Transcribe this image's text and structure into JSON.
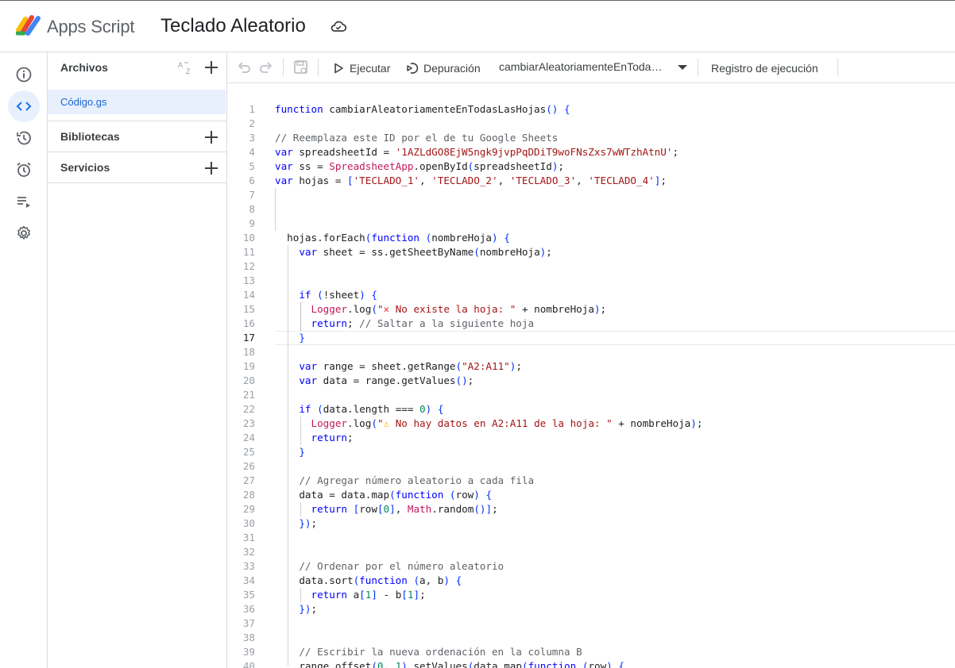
{
  "header": {
    "app_name": "Apps Script",
    "project_title": "Teclado Aleatorio",
    "logo_icon": "apps-script-logo",
    "status_icon": "cloud-saved-icon"
  },
  "rail": {
    "items": [
      {
        "name": "overview",
        "icon": "info-icon"
      },
      {
        "name": "editor",
        "icon": "code-icon",
        "active": true
      },
      {
        "name": "history",
        "icon": "history-icon"
      },
      {
        "name": "triggers",
        "icon": "alarm-icon"
      },
      {
        "name": "executions",
        "icon": "playlist-icon"
      },
      {
        "name": "settings",
        "icon": "gear-icon"
      }
    ]
  },
  "files_panel": {
    "title": "Archivos",
    "files": [
      {
        "label": "Código.gs"
      }
    ],
    "libraries_label": "Bibliotecas",
    "services_label": "Servicios"
  },
  "toolbar": {
    "run_label": "Ejecutar",
    "debug_label": "Depuración",
    "function_selected": "cambiarAleatoriamenteEnToda…",
    "log_label": "Registro de ejecución"
  },
  "editor": {
    "current_line": 17,
    "colors": {
      "keyword": "#0000ff",
      "string": "#a31515",
      "comment": "#5f6368",
      "number": "#098658",
      "class": "#c2185b"
    }
  }
}
